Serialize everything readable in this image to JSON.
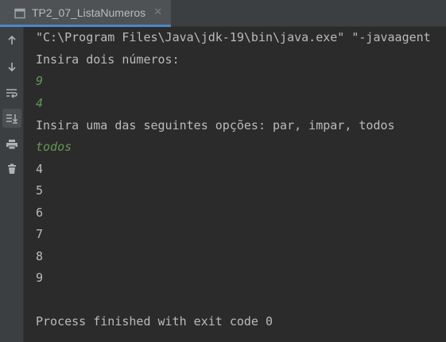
{
  "tab": {
    "title": "TP2_07_ListaNumeros",
    "close_icon": "close-icon"
  },
  "toolbar": {
    "buttons": [
      {
        "icon": "arrow-up-icon"
      },
      {
        "icon": "arrow-down-icon"
      },
      {
        "icon": "soft-wrap-icon"
      },
      {
        "icon": "scroll-to-end-icon",
        "active": true
      },
      {
        "icon": "print-icon"
      },
      {
        "icon": "trash-icon"
      }
    ]
  },
  "console": {
    "lines": [
      {
        "text": "\"C:\\Program Files\\Java\\jdk-19\\bin\\java.exe\" \"-javaagent",
        "type": "output"
      },
      {
        "text": "Insira dois números:",
        "type": "output"
      },
      {
        "text": "9",
        "type": "input"
      },
      {
        "text": "4",
        "type": "input"
      },
      {
        "text": "Insira uma das seguintes opções: par, impar, todos",
        "type": "output"
      },
      {
        "text": "todos",
        "type": "input"
      },
      {
        "text": "4",
        "type": "output"
      },
      {
        "text": "5",
        "type": "output"
      },
      {
        "text": "6",
        "type": "output"
      },
      {
        "text": "7",
        "type": "output"
      },
      {
        "text": "8",
        "type": "output"
      },
      {
        "text": "9",
        "type": "output"
      },
      {
        "text": "",
        "type": "output"
      },
      {
        "text": "Process finished with exit code 0",
        "type": "output"
      }
    ]
  },
  "colors": {
    "background": "#2b2b2b",
    "output_text": "#bbbbbb",
    "input_text": "#629755",
    "tab_accent": "#4a88c7"
  }
}
